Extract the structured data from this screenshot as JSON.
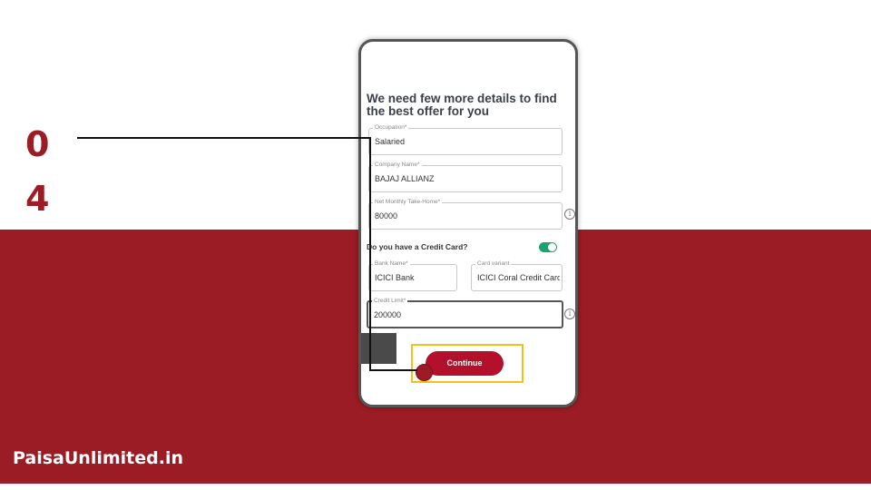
{
  "step": {
    "digit1": "0",
    "digit2": "4"
  },
  "brand": {
    "text": "PaisaUnlimited.in"
  },
  "form": {
    "heading": "We need few more details to find the best offer for you",
    "occupation": {
      "label": "Occupation*",
      "value": "Salaried"
    },
    "company": {
      "label": "Company Name*",
      "value": "BAJAJ ALLIANZ"
    },
    "income": {
      "label": "Net Monthly Take-Home*",
      "value": "80000"
    },
    "credit_card_question": "Do you have a Credit Card?",
    "credit_card_toggle": "on",
    "bank": {
      "label": "Bank Name*",
      "value": "ICICI Bank"
    },
    "variant": {
      "label": "Card variant",
      "value": "ICICI Coral Credit Card"
    },
    "limit": {
      "label": "Credit Limit*",
      "value": "200000"
    },
    "continue_label": "Continue",
    "info_icon": "i"
  },
  "colors": {
    "brand_red": "#9b1c24",
    "button_red": "#b3102b",
    "toggle_green": "#1aa36f",
    "highlight_yellow": "#f2c21b"
  }
}
